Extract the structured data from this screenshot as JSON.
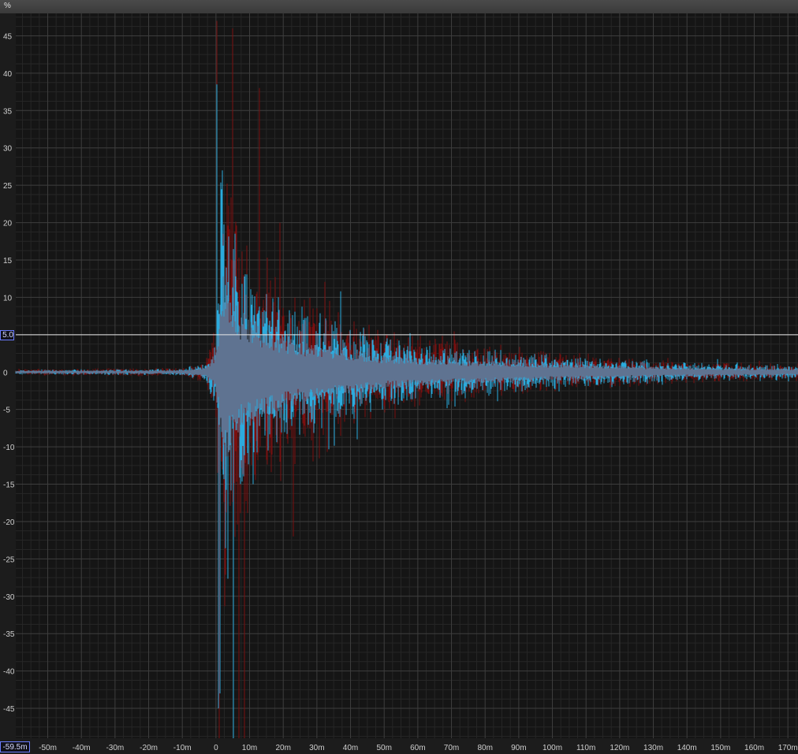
{
  "header": {
    "unit": "%"
  },
  "cursor": {
    "x_readout": "-59.5m",
    "y_readout": "5.0",
    "y_value": 5.0
  },
  "colors": {
    "background": "#151515",
    "grid_major": "#3e3e3e",
    "grid_minor": "#262626",
    "series_left": "#7a0f0f",
    "series_right": "#2ab3e8",
    "overlap": "#5f7391",
    "cursor_line": "#e8e8e8",
    "tick_text": "#cfcfcf"
  },
  "chart_data": {
    "type": "line",
    "title": "",
    "xlabel": "",
    "ylabel": "%",
    "xlim": [
      -59.5,
      173
    ],
    "ylim": [
      -49,
      48
    ],
    "x_ticks": [
      -50,
      -40,
      -30,
      -20,
      -10,
      0,
      10,
      20,
      30,
      40,
      50,
      60,
      70,
      80,
      90,
      100,
      110,
      120,
      130,
      140,
      150,
      160,
      170
    ],
    "x_tick_labels": [
      "-50m",
      "-40m",
      "-30m",
      "-20m",
      "-10m",
      "0",
      "10m",
      "20m",
      "30m",
      "40m",
      "50m",
      "60m",
      "70m",
      "80m",
      "90m",
      "100m",
      "110m",
      "120m",
      "130m",
      "140m",
      "150m",
      "160m",
      "170m"
    ],
    "y_ticks": [
      45,
      40,
      35,
      30,
      25,
      20,
      15,
      10,
      0,
      -5,
      -10,
      -15,
      -20,
      -25,
      -30,
      -35,
      -40,
      -45
    ],
    "y_tick_labels": [
      "45",
      "40",
      "35",
      "30",
      "25",
      "20",
      "15",
      "10",
      "0",
      "-5",
      "-10",
      "-15",
      "-20",
      "-25",
      "-30",
      "-35",
      "-40",
      "-45"
    ],
    "grid": true,
    "series": [
      {
        "color": "#7a0f0f",
        "peaks": [
          {
            "x": 0.3,
            "y": 47
          },
          {
            "x": 0.9,
            "y": -49
          },
          {
            "x": 5.0,
            "y": 46
          },
          {
            "x": 6.8,
            "y": -49
          },
          {
            "x": 8.5,
            "y": -49
          },
          {
            "x": 13.0,
            "y": 38
          },
          {
            "x": 19.0,
            "y": 20
          },
          {
            "x": 23.0,
            "y": -22
          }
        ],
        "envelope_t_ms": [
          -59.5,
          -10,
          -3,
          0,
          2,
          5,
          10,
          15,
          20,
          30,
          40,
          50,
          60,
          80,
          100,
          120,
          140,
          173
        ],
        "envelope_amp": [
          0.4,
          0.5,
          1.5,
          6,
          28,
          22,
          16,
          13,
          11,
          8,
          6.5,
          5,
          4.2,
          3.2,
          2.4,
          1.8,
          1.3,
          0.9
        ]
      },
      {
        "color": "#2ab3e8",
        "peaks": [
          {
            "x": 0.2,
            "y": 38.5
          },
          {
            "x": 0.8,
            "y": -45
          },
          {
            "x": 1.2,
            "y": -43
          },
          {
            "x": 2.0,
            "y": 27
          },
          {
            "x": 5.2,
            "y": -49
          },
          {
            "x": 11.0,
            "y": -15
          },
          {
            "x": 18.5,
            "y": 10
          },
          {
            "x": 42.0,
            "y": -9
          }
        ],
        "envelope_t_ms": [
          -59.5,
          -10,
          -3,
          0,
          2,
          5,
          10,
          15,
          20,
          30,
          40,
          50,
          60,
          80,
          100,
          120,
          140,
          173
        ],
        "envelope_amp": [
          0.3,
          0.4,
          1.2,
          5,
          24,
          18,
          13,
          11,
          9,
          7,
          5.5,
          4.2,
          3.5,
          2.7,
          2.0,
          1.5,
          1.1,
          0.8
        ]
      }
    ]
  }
}
